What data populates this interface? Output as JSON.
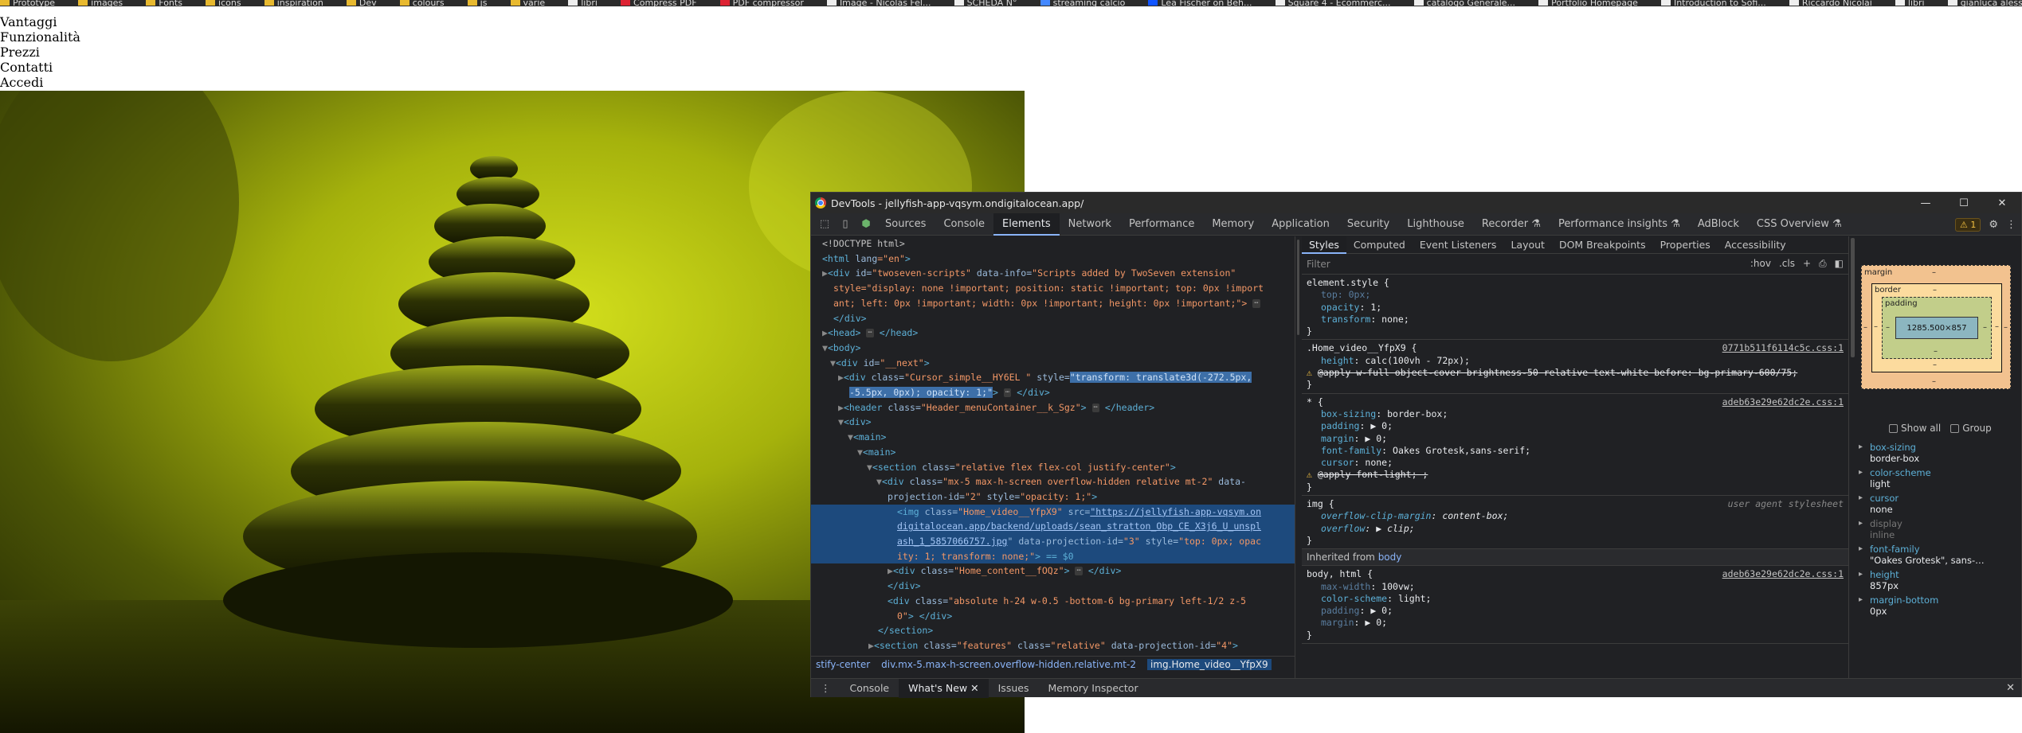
{
  "bookmarks": [
    "Prototype",
    "images",
    "Fonts",
    "icons",
    "inspiration",
    "Dev",
    "colours",
    "js",
    "varie",
    "libri",
    "Compress PDF",
    "PDF compressor",
    "Image - Nicolas Fel...",
    "SCHEDA N°",
    "streaming calcio",
    "Lea Fischer on Beh...",
    "Square 4 - Ecommerc...",
    "catalogo Generale...",
    "Portfolio Homepage",
    "Introduction to Sofi...",
    "Riccardo Nicolai",
    "libri",
    "gianluca alessandri"
  ],
  "site_nav": [
    "Vantaggi",
    "Funzionalità",
    "Prezzi",
    "Contatti",
    "Accedi"
  ],
  "devtools": {
    "title": "DevTools - jellyfish-app-vqsym.ondigitalocean.app/",
    "tabs": [
      "Sources",
      "Console",
      "Elements",
      "Network",
      "Performance",
      "Memory",
      "Application",
      "Security",
      "Lighthouse",
      "Recorder ⚗",
      "Performance insights ⚗",
      "AdBlock",
      "CSS Overview ⚗"
    ],
    "active_tab": "Elements",
    "issues_count": "1",
    "dom": {
      "l1": "<!DOCTYPE html>",
      "l2a": "<html",
      "l2b": " lang",
      "l2c": "=\"en\"",
      "l2d": ">",
      "l3a": "<div",
      "l3b": " id=",
      "l3c": "\"twoseven-scripts\"",
      "l3d": " data-info=",
      "l3e": "\"Scripts added by TwoSeven extension\"",
      "l4": "style=\"display: none !important; position: static !important; top: 0px !import",
      "l5": "ant; left: 0px !important; width: 0px !important; height: 0px !important;\">",
      "l6": "</div>",
      "l7a": "<head>",
      "l7b": "</head>",
      "l8": "<body>",
      "l9a": "<div",
      "l9b": " id=",
      "l9c": "\"__next\"",
      "l9d": ">",
      "l10a": "<div",
      "l10b": " class=",
      "l10c": "\"Cursor_simple__HY6EL  \"",
      "l10d": " style=",
      "l10e": "\"transform: translate3d(-272.5px,",
      "l11": "-5.5px, 0px); opacity: 1;\"",
      "l11b": "</div>",
      "l12a": "<header",
      "l12b": " class=",
      "l12c": "\"Header_menuContainer__k_Sgz\"",
      "l12d": "</header>",
      "l13": "<div>",
      "l14": "<main>",
      "l15": "<main>",
      "l16a": "<section",
      "l16b": " class=",
      "l16c": "\"relative flex flex-col justify-center\"",
      "l16d": ">",
      "l17a": "<div",
      "l17b": " class=",
      "l17c": "\"mx-5 max-h-screen overflow-hidden relative mt-2\"",
      "l17d": " data-",
      "l18a": "projection-id=",
      "l18b": "\"2\"",
      "l18c": " style=",
      "l18d": "\"opacity: 1;\"",
      "l18e": ">",
      "l19a": "<img",
      "l19b": " class=",
      "l19c": "\"Home_video__YfpX9\"",
      "l19d": " src=",
      "l19e": "\"https://jellyfish-app-vqsym.on",
      "l20": "digitalocean.app/backend/uploads/sean_stratton_Obp_CE_X3j6_U_unspl",
      "l21a": "ash_1_5857066757.jpg",
      "l21b": "\" data-projection-id=",
      "l21c": "\"3\"",
      "l21d": " style=",
      "l21e": "\"top: 0px; opac",
      "l22a": "ity: 1; transform: none;\"",
      "l22b": "> == $0",
      "l23a": "<div",
      "l23b": " class=",
      "l23c": "\"Home_content__fOQz\"",
      "l23d": "</div>",
      "l24": "</div>",
      "l25a": "<div",
      "l25b": " class=",
      "l25c": "\"absolute h-24 w-0.5 -bottom-6 bg-primary left-1/2 z-5",
      "l26a": "0\"",
      "l26b": "> </div>",
      "l27": "</section>",
      "l28a": "<section",
      "l28b": " class=",
      "l28c": "\"features\"",
      "l28d": " class=",
      "l28e": "\"relative\"",
      "l28f": " data-projection-id=",
      "l28g": "\"4\"",
      "l28h": ">"
    },
    "breadcrumb": [
      "stify-center",
      "div.mx-5.max-h-screen.overflow-hidden.relative.mt-2",
      "img.Home_video__YfpX9"
    ],
    "styles_tabs": [
      "Styles",
      "Computed",
      "Event Listeners",
      "Layout",
      "DOM Breakpoints",
      "Properties",
      "Accessibility"
    ],
    "filter_placeholder": "Filter",
    "filter_hov": ":hov",
    "filter_cls": ".cls",
    "rules": {
      "r1_sel": "element.style {",
      "r1_p1": "top: 0px;",
      "r1_p2a": "opacity",
      "r1_p2b": ": 1;",
      "r1_p3a": "transform",
      "r1_p3b": ": none;",
      "close": "}",
      "r2_sel": ".Home_video__YfpX9 {",
      "r2_src": "0771b511f6114c5c.css:1",
      "r2_p1a": "height",
      "r2_p1b": ": calc(100vh - 72px);",
      "r2_p2": "@apply w-full object-cover brightness-50 relative text-white before: bg-primary-600/75;",
      "r3_sel": "* {",
      "r3_src": "adeb63e29e62dc2e.css:1",
      "r3_p1a": "box-sizing",
      "r3_p1b": ": border-box;",
      "r3_p2a": "padding",
      "r3_p2b": ": ▶ 0;",
      "r3_p3a": "margin",
      "r3_p3b": ": ▶ 0;",
      "r3_p4a": "font-family",
      "r3_p4b": ": Oakes Grotesk,sans-serif;",
      "r3_p5a": "cursor",
      "r3_p5b": ": none;",
      "r3_p6": "@apply font-light; ;",
      "r4_sel": "img {",
      "r4_ua": "user agent stylesheet",
      "r4_p1a": "overflow-clip-margin",
      "r4_p1b": ": content-box;",
      "r4_p2a": "overflow",
      "r4_p2b": ": ▶ clip;",
      "inherited_label": "Inherited from",
      "inherited_tag": "body",
      "r5_sel": "body, html {",
      "r5_src": "adeb63e29e62dc2e.css:1",
      "r5_p1a": "max-width",
      "r5_p1b": ": 100vw;",
      "r5_p2a": "color-scheme",
      "r5_p2b": ": light;",
      "r5_p3a": "padding",
      "r5_p3b": ": ▶ 0;",
      "r5_p4a": "margin",
      "r5_p4b": ": ▶ 0;"
    },
    "boxmodel": {
      "margin": "margin",
      "border": "border",
      "padding": "padding",
      "dash": "–",
      "content": "1285.500×857"
    },
    "computed": {
      "show_all": "Show all",
      "group": "Group",
      "props": [
        {
          "k": "box-sizing",
          "v": "border-box"
        },
        {
          "k": "color-scheme",
          "v": "light"
        },
        {
          "k": "cursor",
          "v": "none"
        },
        {
          "k": "display",
          "v": "inline"
        },
        {
          "k": "font-family",
          "v": "\"Oakes Grotesk\", sans-…"
        },
        {
          "k": "height",
          "v": "857px"
        },
        {
          "k": "margin-bottom",
          "v": "0px"
        }
      ]
    },
    "drawer_tabs": [
      "Console",
      "What's New",
      "Issues",
      "Memory Inspector"
    ],
    "drawer_active": "What's New"
  },
  "colors": {
    "hero_tint": "#c8d40f",
    "devtools_bg": "#202124",
    "selection": "#1d4a7d"
  }
}
